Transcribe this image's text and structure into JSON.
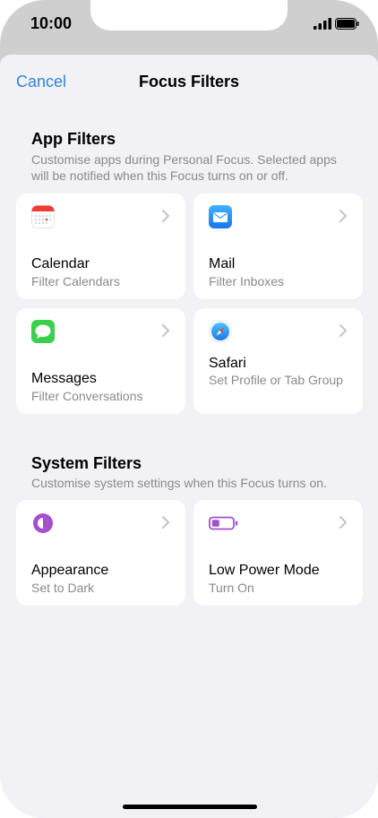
{
  "status": {
    "time": "10:00"
  },
  "nav": {
    "cancel": "Cancel",
    "title": "Focus Filters"
  },
  "app_filters": {
    "title": "App Filters",
    "subtitle": "Customise apps during Personal Focus. Selected apps will be notified when this Focus turns on or off.",
    "cards": [
      {
        "name": "Calendar",
        "desc": "Filter Calendars",
        "icon": "calendar-icon"
      },
      {
        "name": "Mail",
        "desc": "Filter Inboxes",
        "icon": "mail-icon"
      },
      {
        "name": "Messages",
        "desc": "Filter Conversations",
        "icon": "messages-icon"
      },
      {
        "name": "Safari",
        "desc": "Set Profile or Tab Group",
        "icon": "safari-icon"
      }
    ]
  },
  "system_filters": {
    "title": "System Filters",
    "subtitle": "Customise system settings when this Focus turns on.",
    "cards": [
      {
        "name": "Appearance",
        "desc": "Set to Dark",
        "icon": "appearance-icon"
      },
      {
        "name": "Low Power Mode",
        "desc": "Turn On",
        "icon": "battery-low-power-icon"
      }
    ]
  },
  "colors": {
    "accent": "#2e86d6",
    "secondary_text": "#8a8a8e",
    "background": "#f1f1f6",
    "purple": "#a34fd0",
    "green": "#3ccf4e"
  }
}
